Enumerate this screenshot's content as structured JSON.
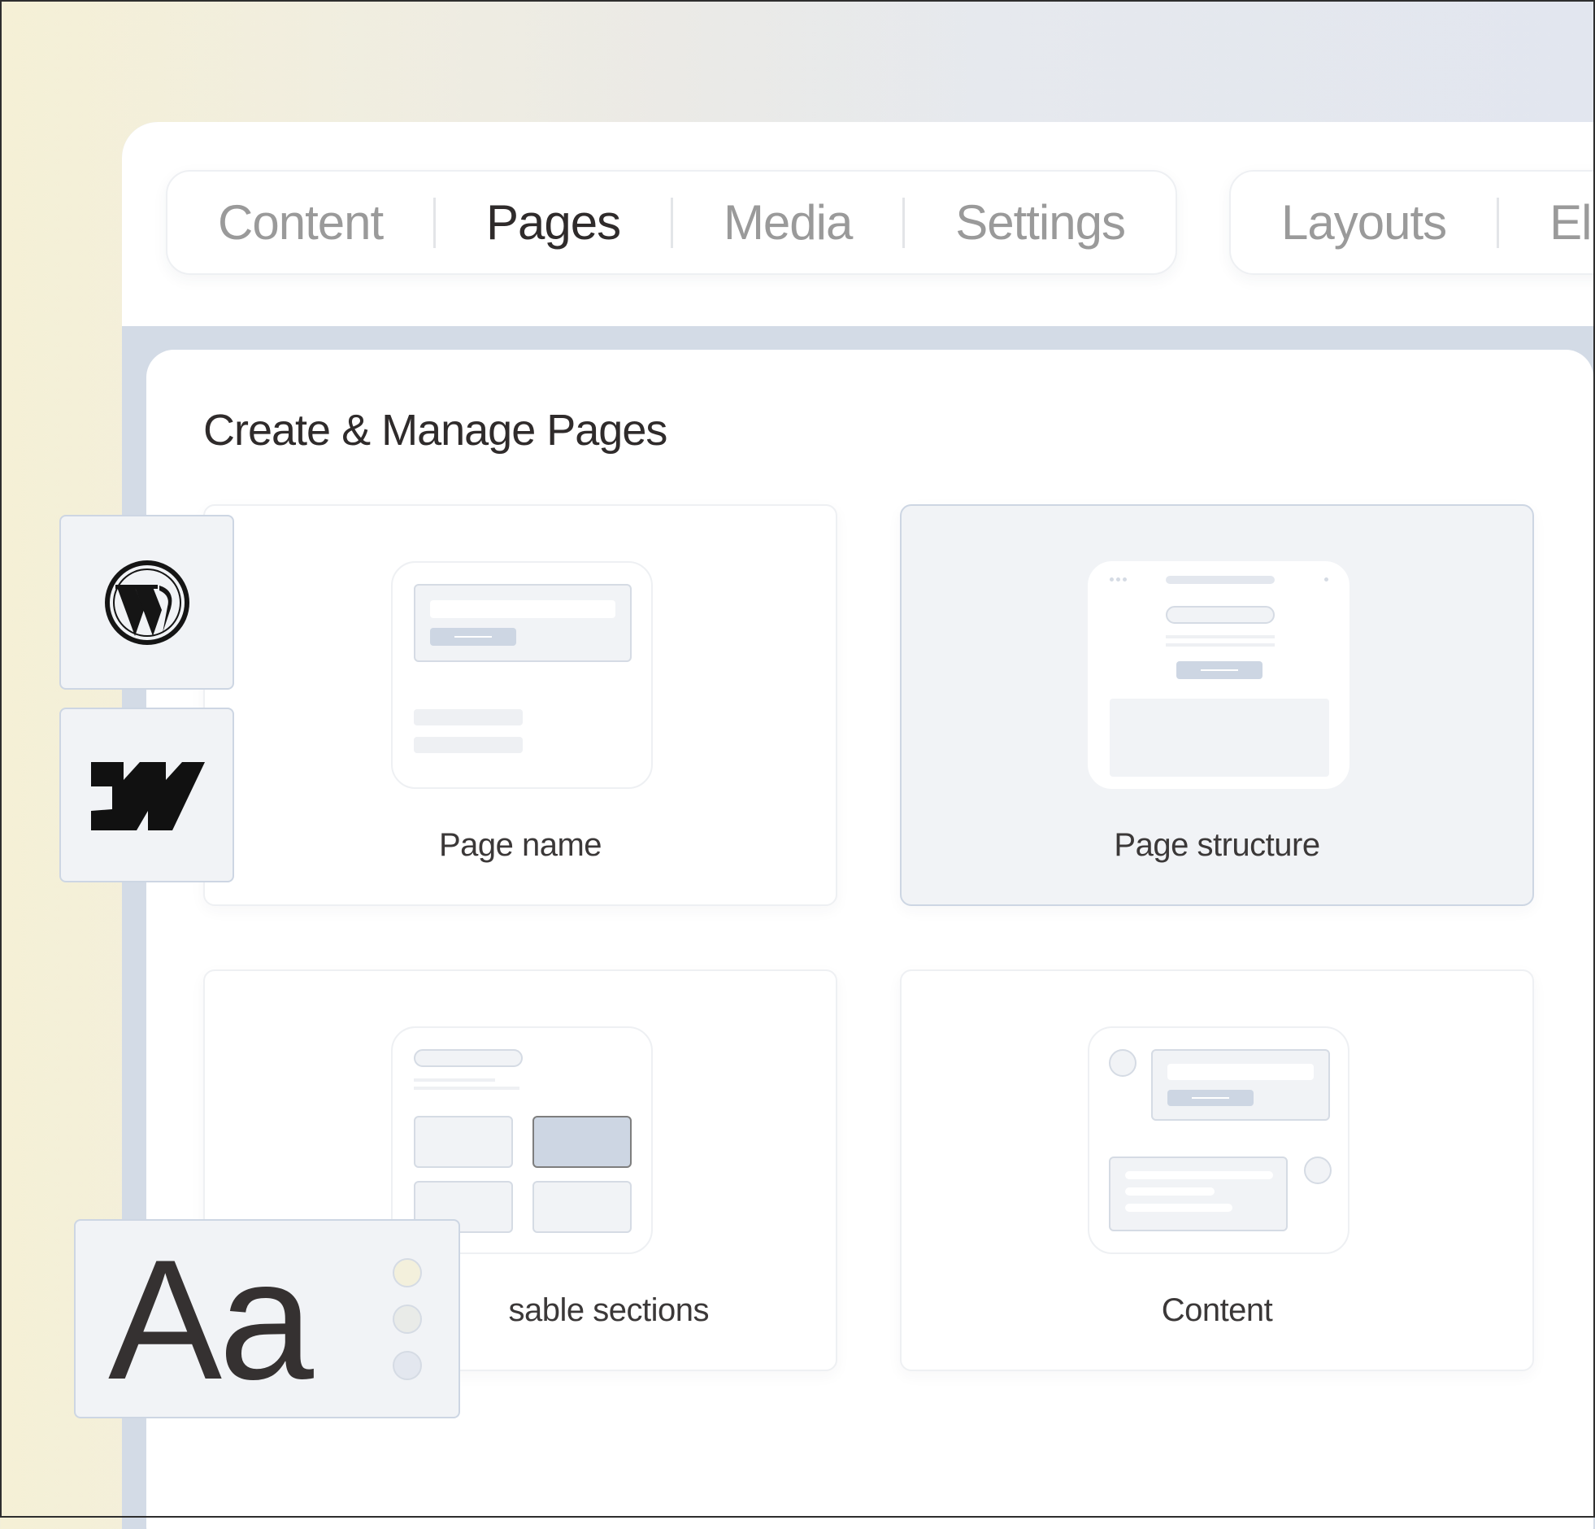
{
  "tabs_primary": [
    {
      "label": "Content",
      "active": false
    },
    {
      "label": "Pages",
      "active": true
    },
    {
      "label": "Media",
      "active": false
    },
    {
      "label": "Settings",
      "active": false
    }
  ],
  "tabs_secondary": [
    {
      "label": "Layouts"
    },
    {
      "label": "Ele"
    }
  ],
  "panel": {
    "title": "Create & Manage Pages",
    "cards": [
      {
        "label": "Page name",
        "selected": false
      },
      {
        "label": "Page structure",
        "selected": true
      },
      {
        "label": "sable sections",
        "selected": false
      },
      {
        "label": "Content",
        "selected": false
      }
    ]
  },
  "integrations": [
    {
      "name": "wordpress-icon"
    },
    {
      "name": "webflow-icon"
    }
  ],
  "typography_tile": {
    "sample": "Aa",
    "swatches": [
      "#f3f0dc",
      "#e9ebe8",
      "#e3e7ef"
    ]
  },
  "colors": {
    "active_tab": "#2f2b2b",
    "inactive_tab": "#9a9a9a",
    "accent_fill": "#cdd6e3",
    "selected_card_bg": "#f1f3f6"
  }
}
